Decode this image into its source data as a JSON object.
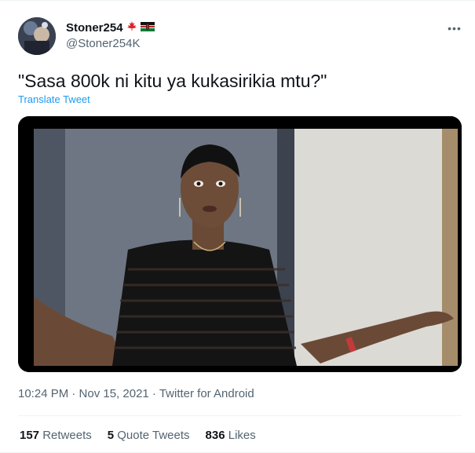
{
  "user": {
    "display_name": "Stoner254",
    "handle": "@Stoner254K",
    "flags": [
      "canada-flag-icon",
      "kenya-flag-icon"
    ]
  },
  "tweet": {
    "text": "\"Sasa 800k ni kitu ya kukasirikia mtu?\"",
    "translate_label": "Translate Tweet",
    "timestamp": "10:24 PM · Nov 15, 2021 · Twitter for Android"
  },
  "stats": {
    "retweets_count": "157",
    "retweets_label": "Retweets",
    "quotes_count": "5",
    "quotes_label": "Quote Tweets",
    "likes_count": "836",
    "likes_label": "Likes"
  },
  "icons": {
    "more": "more-options-icon",
    "media": "video-frame"
  },
  "colors": {
    "accent": "#1d9bf0",
    "text": "#0f1419",
    "secondary": "#536471"
  }
}
